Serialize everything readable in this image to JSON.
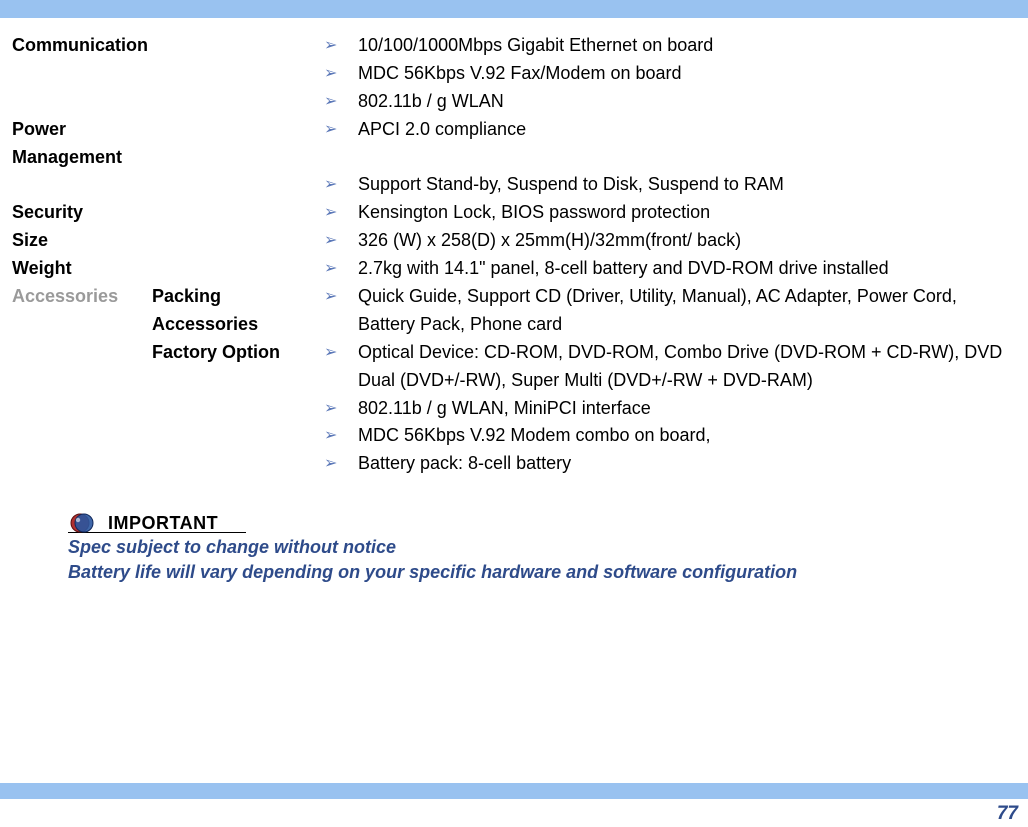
{
  "specs": [
    {
      "category": "Communication",
      "sub": "",
      "items": [
        "10/100/1000Mbps Gigabit Ethernet on board",
        "MDC 56Kbps V.92 Fax/Modem on board",
        "802.11b / g WLAN"
      ]
    },
    {
      "category": "Power Management",
      "sub": "",
      "items": [
        "APCI 2.0 compliance",
        "Support Stand-by, Suspend to Disk, Suspend to RAM"
      ]
    },
    {
      "category": "Security",
      "sub": "",
      "items": [
        "Kensington Lock, BIOS password protection"
      ]
    },
    {
      "category": "Size",
      "sub": "",
      "items": [
        "326 (W) x 258(D) x 25mm(H)/32mm(front/ back)"
      ]
    },
    {
      "category": "Weight",
      "sub": "",
      "items": [
        "2.7kg with 14.1\" panel, 8-cell battery and DVD-ROM drive installed"
      ]
    },
    {
      "category": "Accessories",
      "category_dim": true,
      "sub": "Packing Accessories",
      "items": [
        "Quick Guide, Support CD (Driver, Utility, Manual), AC Adapter, Power Cord, Battery Pack, Phone card"
      ]
    },
    {
      "category": "",
      "sub": "Factory Option",
      "items": [
        "Optical Device: CD-ROM, DVD-ROM, Combo Drive (DVD-ROM + CD-RW), DVD Dual (DVD+/-RW), Super Multi (DVD+/-RW + DVD-RAM)",
        "802.11b / g WLAN, MiniPCI interface",
        "MDC 56Kbps V.92 Modem combo on board,",
        "Battery pack: 8-cell battery"
      ]
    }
  ],
  "important": {
    "label": "IMPORTANT",
    "notes": [
      "Spec subject to change without notice",
      "Battery life will vary depending on your specific hardware and software configuration"
    ]
  },
  "page_number": "77"
}
